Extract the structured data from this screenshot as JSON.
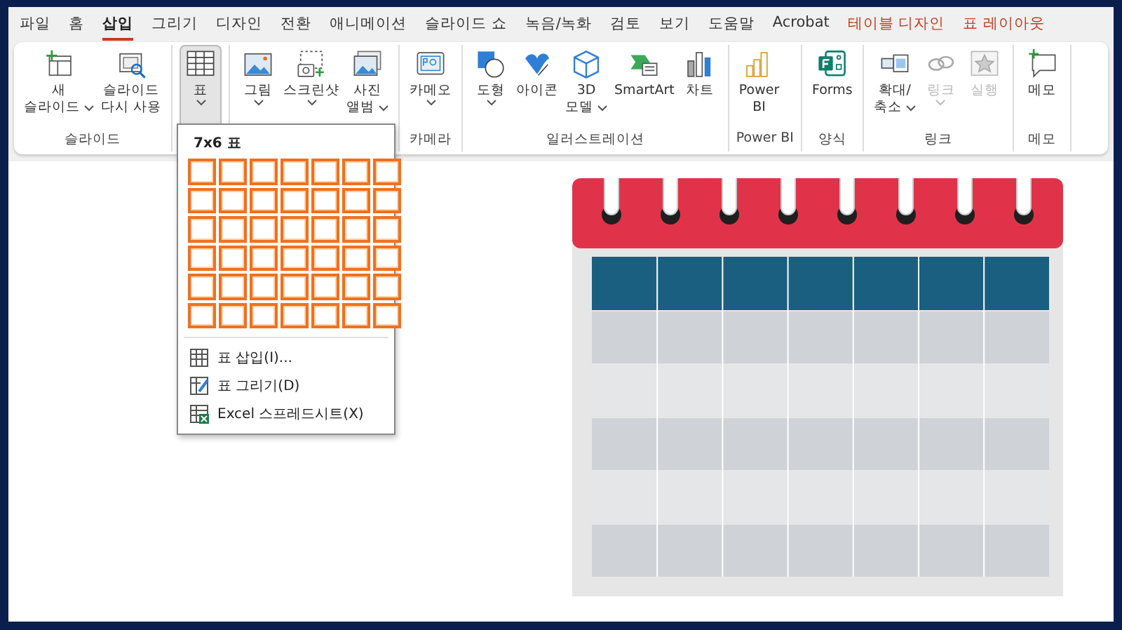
{
  "tabs": [
    {
      "label": "파일",
      "selected": false,
      "kind": "normal"
    },
    {
      "label": "홈",
      "selected": false,
      "kind": "normal"
    },
    {
      "label": "삽입",
      "selected": true,
      "kind": "normal"
    },
    {
      "label": "그리기",
      "selected": false,
      "kind": "normal"
    },
    {
      "label": "디자인",
      "selected": false,
      "kind": "normal"
    },
    {
      "label": "전환",
      "selected": false,
      "kind": "normal"
    },
    {
      "label": "애니메이션",
      "selected": false,
      "kind": "normal"
    },
    {
      "label": "슬라이드 쇼",
      "selected": false,
      "kind": "normal"
    },
    {
      "label": "녹음/녹화",
      "selected": false,
      "kind": "normal"
    },
    {
      "label": "검토",
      "selected": false,
      "kind": "normal"
    },
    {
      "label": "보기",
      "selected": false,
      "kind": "normal"
    },
    {
      "label": "도움말",
      "selected": false,
      "kind": "normal"
    },
    {
      "label": "Acrobat",
      "selected": false,
      "kind": "normal"
    },
    {
      "label": "테이블 디자인",
      "selected": false,
      "kind": "contextual"
    },
    {
      "label": "표 레이아웃",
      "selected": false,
      "kind": "contextual"
    }
  ],
  "ribbon_groups": [
    {
      "label": "슬라이드",
      "items": [
        {
          "lines": [
            "새",
            "슬라이드"
          ],
          "dropdown": true,
          "pressed": false,
          "disabled": false
        },
        {
          "lines": [
            "슬라이드",
            "다시 사용"
          ],
          "dropdown": false,
          "pressed": false,
          "disabled": false
        }
      ]
    },
    {
      "items": [
        {
          "lines": [
            "표"
          ],
          "dropdown": true,
          "pressed": true,
          "disabled": false
        }
      ]
    },
    {
      "items": [
        {
          "lines": [
            "그림"
          ],
          "dropdown": true,
          "pressed": false,
          "disabled": false
        },
        {
          "lines": [
            "스크린샷"
          ],
          "dropdown": true,
          "pressed": false,
          "disabled": false
        },
        {
          "lines": [
            "사진",
            "앨범"
          ],
          "dropdown": true,
          "pressed": false,
          "disabled": false
        }
      ]
    },
    {
      "label": "카메라",
      "items": [
        {
          "lines": [
            "카메오"
          ],
          "dropdown": true,
          "pressed": false,
          "disabled": false
        }
      ]
    },
    {
      "label": "일러스트레이션",
      "items": [
        {
          "lines": [
            "도형"
          ],
          "dropdown": true,
          "pressed": false,
          "disabled": false
        },
        {
          "lines": [
            "아이콘"
          ],
          "dropdown": false,
          "pressed": false,
          "disabled": false
        },
        {
          "lines": [
            "3D",
            "모델"
          ],
          "dropdown": true,
          "pressed": false,
          "disabled": false
        },
        {
          "lines": [
            "SmartArt"
          ],
          "dropdown": false,
          "pressed": false,
          "disabled": false
        },
        {
          "lines": [
            "차트"
          ],
          "dropdown": false,
          "pressed": false,
          "disabled": false
        }
      ]
    },
    {
      "label": "Power BI",
      "items": [
        {
          "lines": [
            "Power",
            "BI"
          ],
          "dropdown": false,
          "pressed": false,
          "disabled": false
        }
      ]
    },
    {
      "label": "양식",
      "items": [
        {
          "lines": [
            "Forms"
          ],
          "dropdown": false,
          "pressed": false,
          "disabled": false
        }
      ]
    },
    {
      "label": "링크",
      "items": [
        {
          "lines": [
            "확대/",
            "축소"
          ],
          "dropdown": true,
          "pressed": false,
          "disabled": false
        },
        {
          "lines": [
            "링크"
          ],
          "dropdown": true,
          "pressed": false,
          "disabled": true
        },
        {
          "lines": [
            "실행"
          ],
          "dropdown": false,
          "pressed": false,
          "disabled": true
        }
      ]
    },
    {
      "label": "메모",
      "items": [
        {
          "lines": [
            "메모"
          ],
          "dropdown": false,
          "pressed": false,
          "disabled": false
        }
      ]
    }
  ],
  "table_menu": {
    "title": "7x6 표",
    "grid": [
      [
        {
          "selected": true
        },
        {
          "selected": true
        },
        {
          "selected": true
        },
        {
          "selected": true
        },
        {
          "selected": true
        },
        {
          "selected": true
        },
        {
          "selected": true
        }
      ],
      [
        {
          "selected": true
        },
        {
          "selected": true
        },
        {
          "selected": true
        },
        {
          "selected": true
        },
        {
          "selected": true
        },
        {
          "selected": true
        },
        {
          "selected": true
        }
      ],
      [
        {
          "selected": true
        },
        {
          "selected": true
        },
        {
          "selected": true
        },
        {
          "selected": true
        },
        {
          "selected": true
        },
        {
          "selected": true
        },
        {
          "selected": true
        }
      ],
      [
        {
          "selected": true
        },
        {
          "selected": true
        },
        {
          "selected": true
        },
        {
          "selected": true
        },
        {
          "selected": true
        },
        {
          "selected": true
        },
        {
          "selected": true
        }
      ],
      [
        {
          "selected": true
        },
        {
          "selected": true
        },
        {
          "selected": true
        },
        {
          "selected": true
        },
        {
          "selected": true
        },
        {
          "selected": true
        },
        {
          "selected": true
        }
      ],
      [
        {
          "selected": true
        },
        {
          "selected": true
        },
        {
          "selected": true
        },
        {
          "selected": true
        },
        {
          "selected": true
        },
        {
          "selected": true
        },
        {
          "selected": true
        }
      ]
    ],
    "items": [
      "표 삽입(I)...",
      "표 그리기(D)",
      "Excel 스프레드시트(X)"
    ]
  }
}
